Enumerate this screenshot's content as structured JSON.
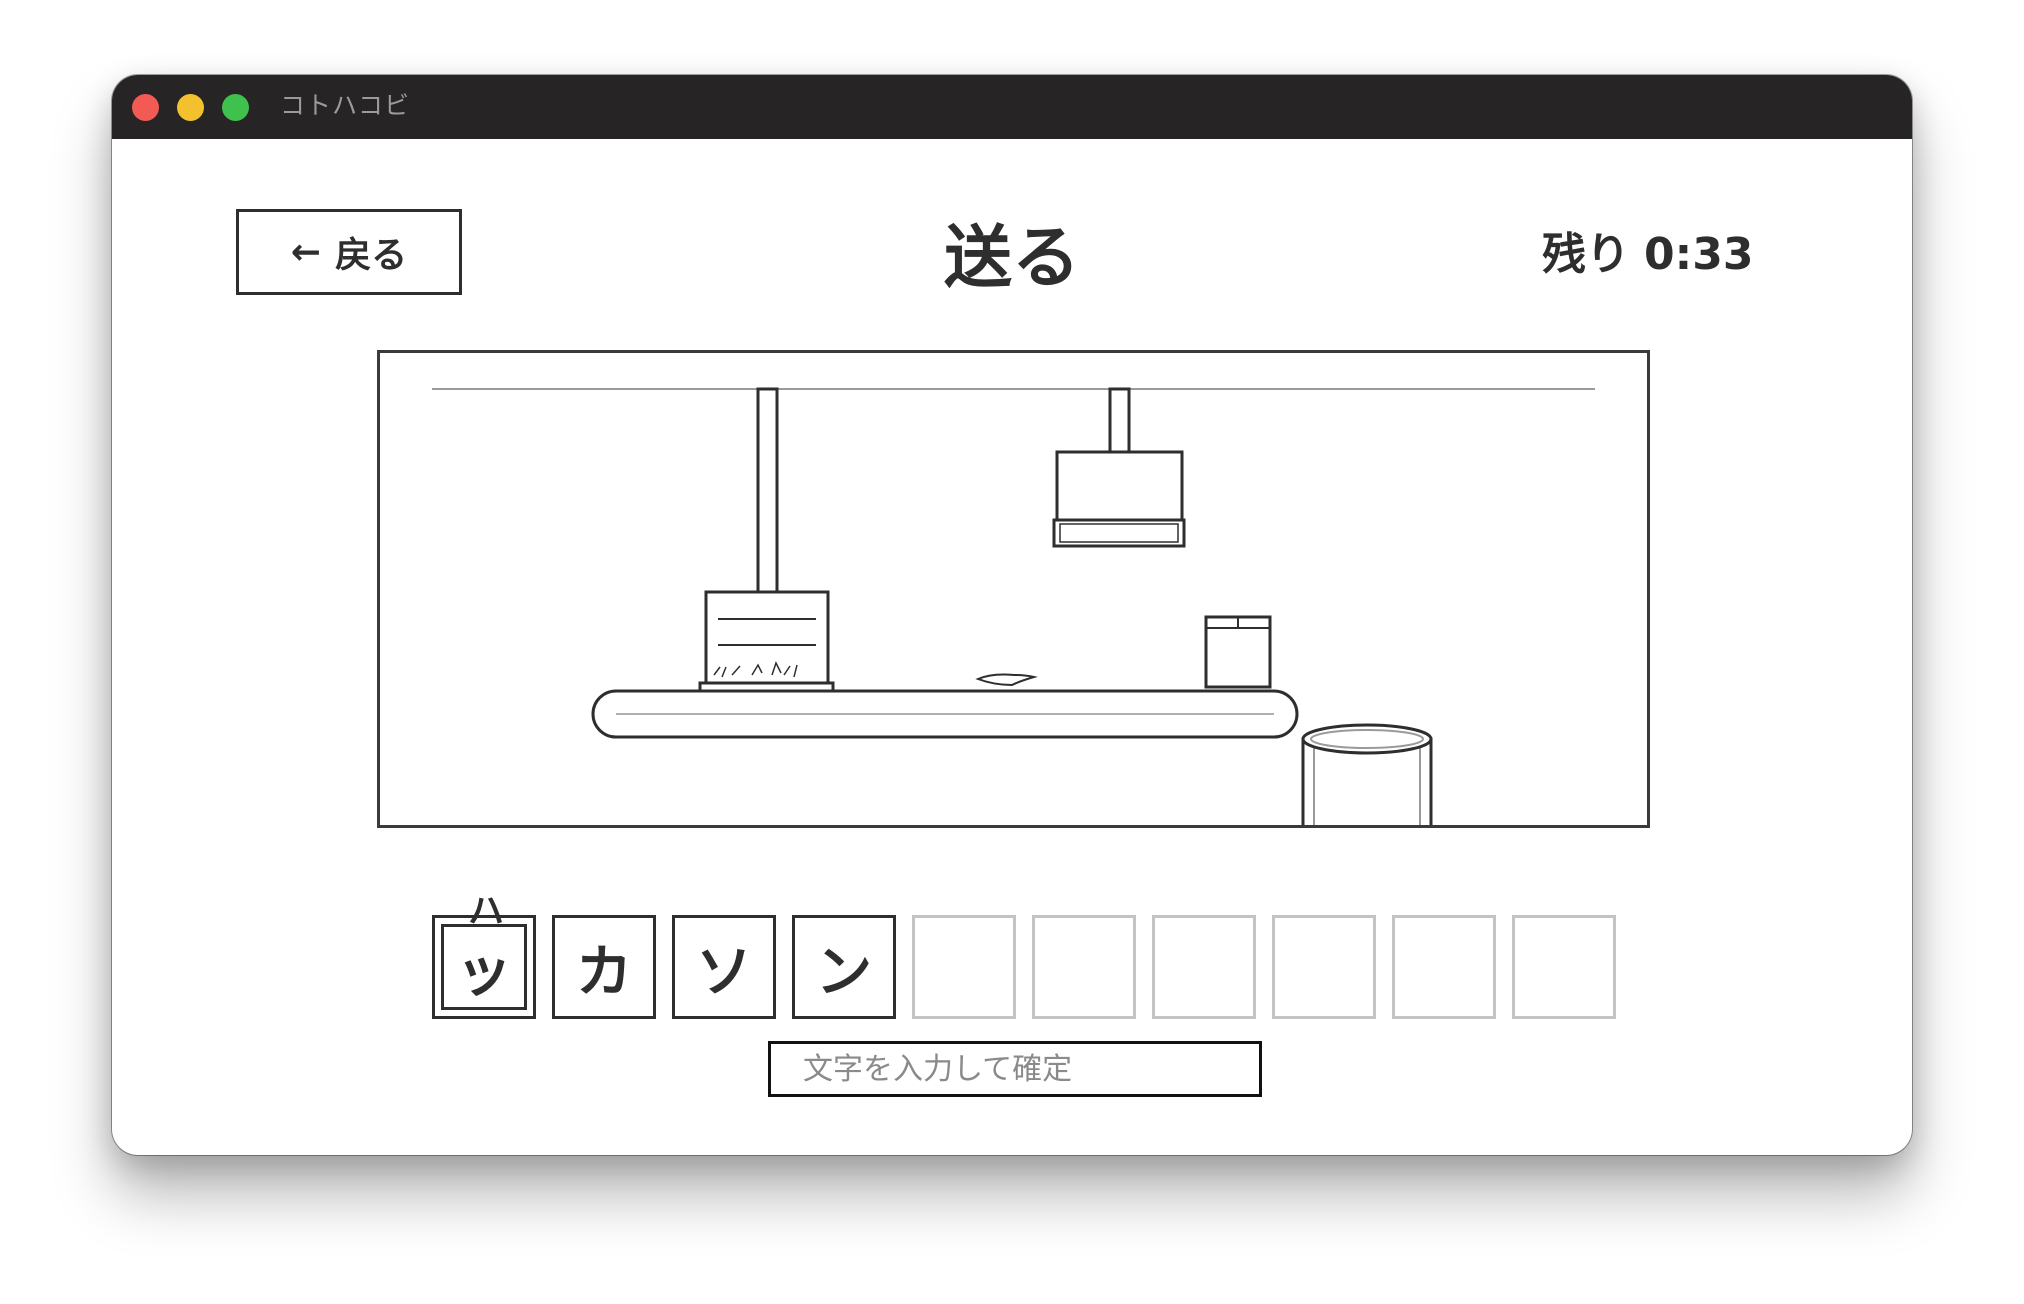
{
  "window": {
    "app_title": "コトハコビ"
  },
  "header": {
    "back_icon": "←",
    "back_label": "戻る",
    "title": "送る",
    "timer_label": "残り",
    "timer_value": "0:33"
  },
  "scene": {
    "objects": [
      "ceiling-rail",
      "stamp-press-down",
      "stamp-press-raised",
      "conveyor-belt",
      "paper-scrap",
      "small-box",
      "trash-can"
    ]
  },
  "word": {
    "hint": "ハ",
    "tiles": [
      "ッ",
      "カ",
      "ソ",
      "ン",
      "",
      "",
      "",
      "",
      "",
      ""
    ],
    "active_index": 0
  },
  "input": {
    "placeholder": "文字を入力して確定",
    "value": ""
  },
  "colors": {
    "titlebar": "#262424",
    "ink": "#2e2e2e",
    "empty_tile": "#c4c4c4"
  }
}
